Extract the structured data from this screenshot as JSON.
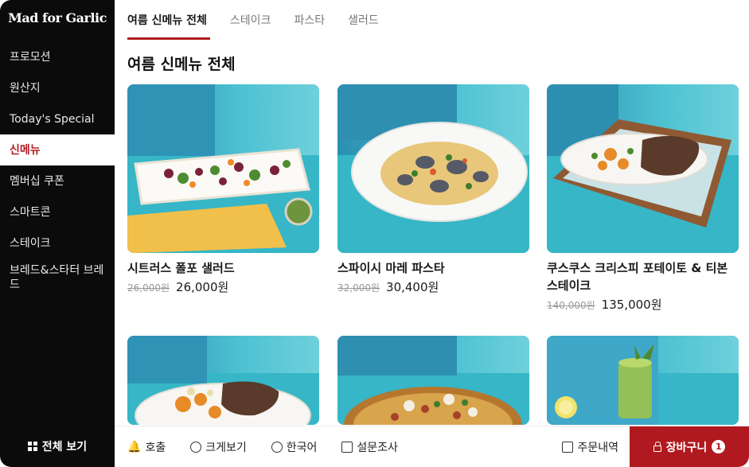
{
  "brand": {
    "logo_text": "Mad for Garlic"
  },
  "sidebar": {
    "items": [
      {
        "label": "프로모션"
      },
      {
        "label": "원산지"
      },
      {
        "label": "Today's Special"
      },
      {
        "label": "신메뉴",
        "active": true
      },
      {
        "label": "멤버십 쿠폰"
      },
      {
        "label": "스마트콘"
      },
      {
        "label": "스테이크"
      },
      {
        "label": "브레드&스타터 브레드"
      }
    ],
    "view_all_label": "전체 보기"
  },
  "tabs": [
    {
      "label": "여름 신메뉴 전체",
      "active": true
    },
    {
      "label": "스테이크"
    },
    {
      "label": "파스타"
    },
    {
      "label": "샐러드"
    }
  ],
  "section_title": "여름 신메뉴 전체",
  "products": [
    {
      "name": "시트러스 폴포 샐러드",
      "old_price": "26,000원",
      "price": "26,000원"
    },
    {
      "name": "스파이시 마레 파스타",
      "old_price": "32,000원",
      "price": "30,400원"
    },
    {
      "name": "쿠스쿠스 크리스피 포테이토 & 티본 스테이크",
      "old_price": "140,000원",
      "price": "135,000원"
    },
    {
      "name": "",
      "old_price": "",
      "price": ""
    },
    {
      "name": "",
      "old_price": "",
      "price": ""
    },
    {
      "name": "",
      "old_price": "",
      "price": ""
    }
  ],
  "bottom_bar": {
    "call_label": "호출",
    "zoom_label": "크게보기",
    "language_label": "한국어",
    "survey_label": "설문조사",
    "order_history_label": "주문내역",
    "cart_label": "장바구니",
    "cart_count": "1"
  },
  "colors": {
    "accent": "#b0191f",
    "sidebar_bg": "#0b0b0b",
    "scene_teal": "#36b6c7"
  }
}
